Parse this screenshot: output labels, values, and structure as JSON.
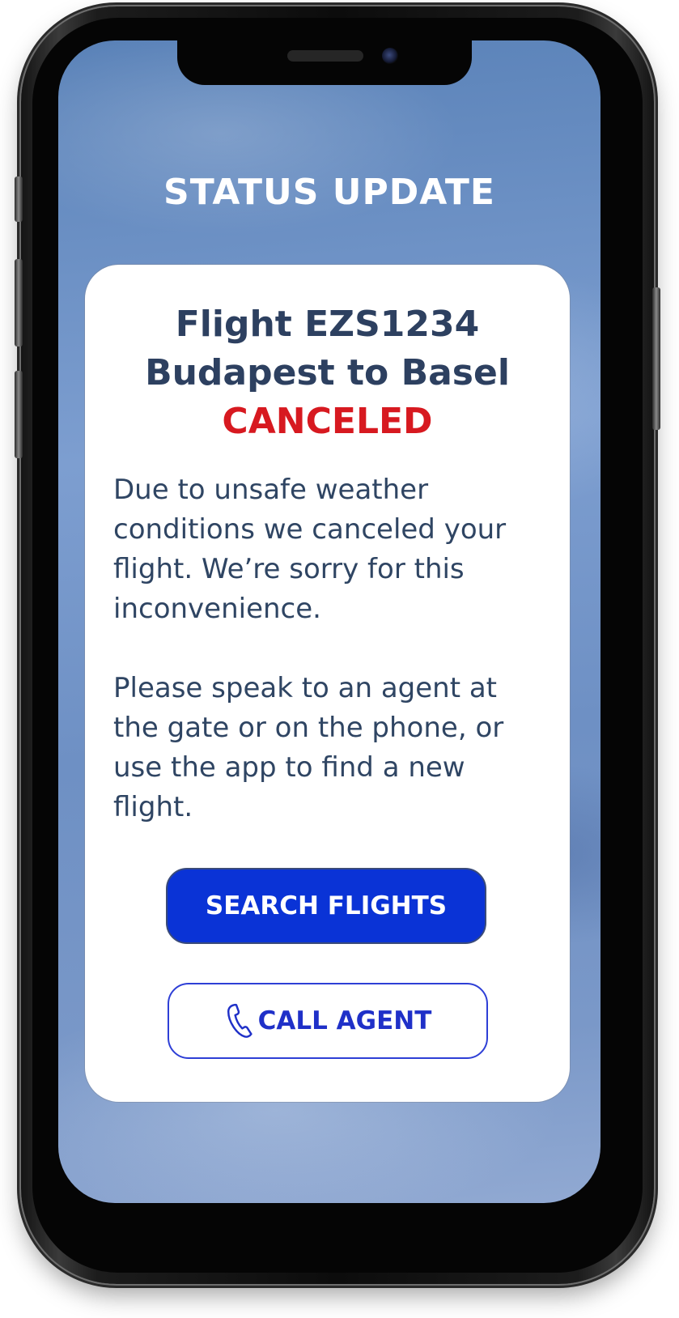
{
  "screen": {
    "header_title": "STATUS UPDATE"
  },
  "card": {
    "flight_line": "Flight EZS1234",
    "route_line": "Budapest to Basel",
    "status": "CANCELED",
    "message_1": "Due to unsafe weather conditions we canceled your flight. We’re sorry for this inconvenience.",
    "message_2": "Please speak to an agent at the gate or on the phone, or use the app to find a new flight."
  },
  "actions": {
    "search_label": "SEARCH FLIGHTS",
    "call_label": "CALL AGENT",
    "call_icon": "phone-icon"
  },
  "colors": {
    "title": "#2d4060",
    "status_canceled": "#d71920",
    "primary_button": "#0a33d6",
    "secondary_button_border": "#2e3fd6"
  }
}
